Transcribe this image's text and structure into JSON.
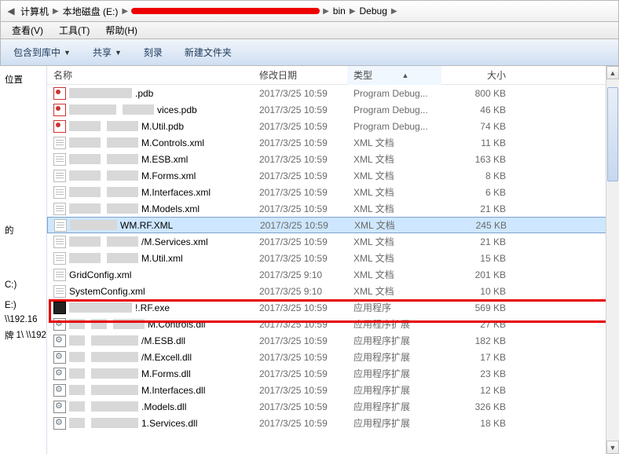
{
  "breadcrumb": {
    "pc": "计算机",
    "drive": "本地磁盘 (E:)",
    "bin": "bin",
    "debug": "Debug"
  },
  "menubar": {
    "view": "查看(V)",
    "tools": "工具(T)",
    "help": "帮助(H)"
  },
  "toolbar": {
    "include": "包含到库中",
    "share": "共享",
    "burn": "刻录",
    "newfolder": "新建文件夹"
  },
  "sidebar": {
    "loc": "位置",
    "c": "C:)",
    "e": "E:)",
    "net": "\\\\192.16",
    "net2": "1\\  \\\\192"
  },
  "columns": {
    "name": "名称",
    "modified": "修改日期",
    "type": "类型",
    "size": "大小"
  },
  "files": [
    {
      "name_suffix": ".pdb",
      "icon": "pdb",
      "pix": [
        "w80"
      ],
      "mod": "2017/3/25 10:59",
      "type": "Program Debug...",
      "size": "800 KB"
    },
    {
      "name_suffix": "vices.pdb",
      "icon": "pdb",
      "pix": [
        "w60",
        "w40"
      ],
      "mod": "2017/3/25 10:59",
      "type": "Program Debug...",
      "size": "46 KB"
    },
    {
      "name_suffix": "M.Util.pdb",
      "icon": "pdb",
      "pix": [
        "w40",
        "w40"
      ],
      "mod": "2017/3/25 10:59",
      "type": "Program Debug...",
      "size": "74 KB"
    },
    {
      "name_suffix": "M.Controls.xml",
      "icon": "xml",
      "pix": [
        "w40",
        "w40"
      ],
      "mod": "2017/3/25 10:59",
      "type": "XML 文档",
      "size": "11 KB"
    },
    {
      "name_suffix": "M.ESB.xml",
      "icon": "xml",
      "pix": [
        "w40",
        "w40"
      ],
      "mod": "2017/3/25 10:59",
      "type": "XML 文档",
      "size": "163 KB"
    },
    {
      "name_suffix": "M.Forms.xml",
      "icon": "xml",
      "pix": [
        "w40",
        "w40"
      ],
      "mod": "2017/3/25 10:59",
      "type": "XML 文档",
      "size": "8 KB"
    },
    {
      "name_suffix": "M.Interfaces.xml",
      "icon": "xml",
      "pix": [
        "w40",
        "w40"
      ],
      "mod": "2017/3/25 10:59",
      "type": "XML 文档",
      "size": "6 KB"
    },
    {
      "name_suffix": "M.Models.xml",
      "icon": "xml",
      "pix": [
        "w40",
        "w40"
      ],
      "mod": "2017/3/25 10:59",
      "type": "XML 文档",
      "size": "21 KB"
    },
    {
      "name_suffix": "WM.RF.XML",
      "icon": "xml",
      "pix": [
        "w60"
      ],
      "mod": "2017/3/25 10:59",
      "type": "XML 文档",
      "size": "245 KB",
      "selected": true
    },
    {
      "name_suffix": "/M.Services.xml",
      "icon": "xml",
      "pix": [
        "w40",
        "w40"
      ],
      "mod": "2017/3/25 10:59",
      "type": "XML 文档",
      "size": "21 KB"
    },
    {
      "name_suffix": "M.Util.xml",
      "icon": "xml",
      "pix": [
        "w40",
        "w40"
      ],
      "mod": "2017/3/25 10:59",
      "type": "XML 文档",
      "size": "15 KB"
    },
    {
      "name_suffix": "GridConfig.xml",
      "icon": "xml",
      "pix": [],
      "mod": "2017/3/25 9:10",
      "type": "XML 文档",
      "size": "201 KB"
    },
    {
      "name_suffix": "SystemConfig.xml",
      "icon": "xml",
      "pix": [],
      "mod": "2017/3/25 9:10",
      "type": "XML 文档",
      "size": "10 KB"
    },
    {
      "name_suffix": "!.RF.exe",
      "icon": "exe",
      "pix": [
        "w80"
      ],
      "mod": "2017/3/25 10:59",
      "type": "应用程序",
      "size": "569 KB",
      "highlight": true
    },
    {
      "name_suffix": "M.Controls.dll",
      "icon": "dll",
      "pix": [
        "w20",
        "w20",
        "w40"
      ],
      "mod": "2017/3/25 10:59",
      "type": "应用程序扩展",
      "size": "27 KB"
    },
    {
      "name_suffix": "/M.ESB.dll",
      "icon": "dll",
      "pix": [
        "w20",
        "w60"
      ],
      "mod": "2017/3/25 10:59",
      "type": "应用程序扩展",
      "size": "182 KB"
    },
    {
      "name_suffix": "/M.Excell.dll",
      "icon": "dll",
      "pix": [
        "w20",
        "w60"
      ],
      "mod": "2017/3/25 10:59",
      "type": "应用程序扩展",
      "size": "17 KB"
    },
    {
      "name_suffix": "M.Forms.dll",
      "icon": "dll",
      "pix": [
        "w20",
        "w60"
      ],
      "mod": "2017/3/25 10:59",
      "type": "应用程序扩展",
      "size": "23 KB"
    },
    {
      "name_suffix": "M.Interfaces.dll",
      "icon": "dll",
      "pix": [
        "w20",
        "w60"
      ],
      "mod": "2017/3/25 10:59",
      "type": "应用程序扩展",
      "size": "12 KB"
    },
    {
      "name_suffix": ".Models.dll",
      "icon": "dll",
      "pix": [
        "w20",
        "w60"
      ],
      "mod": "2017/3/25 10:59",
      "type": "应用程序扩展",
      "size": "326 KB"
    },
    {
      "name_suffix": "1.Services.dll",
      "icon": "dll",
      "pix": [
        "w20",
        "w60"
      ],
      "mod": "2017/3/25 10:59",
      "type": "应用程序扩展",
      "size": "18 KB"
    }
  ]
}
